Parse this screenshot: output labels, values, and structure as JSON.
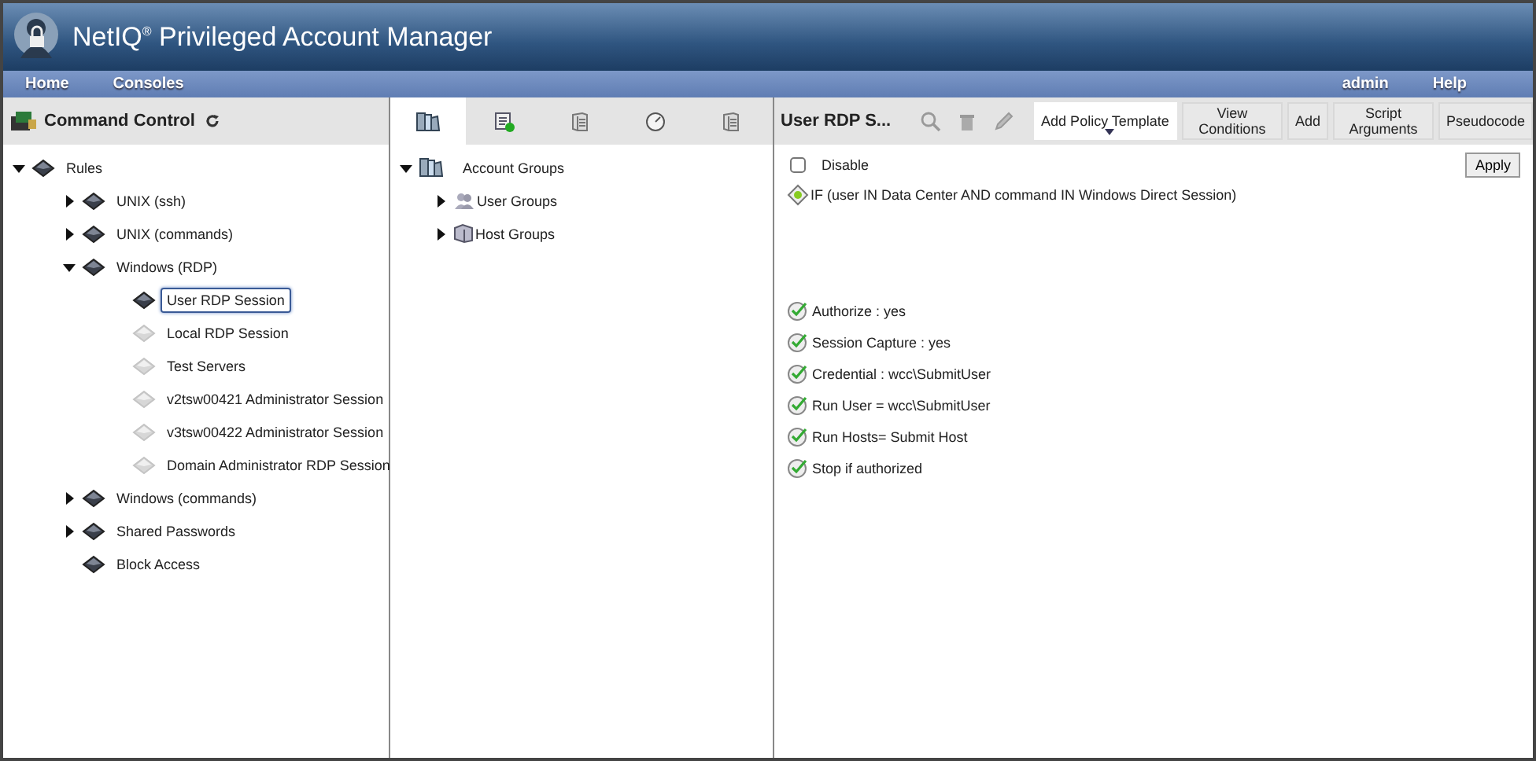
{
  "header": {
    "title": "NetIQ$^{®}$ Privileged Account Manager"
  },
  "menu": {
    "left": [
      "Home",
      "Consoles"
    ],
    "right": [
      "admin",
      "Help"
    ]
  },
  "left_panel": {
    "title": "Command Control",
    "tree": [
      {
        "label": "Rules",
        "expanded": true,
        "disabled": false,
        "selected": false,
        "children": [
          {
            "label": "UNIX (ssh)",
            "expanded": false,
            "disabled": false,
            "selected": false
          },
          {
            "label": "UNIX (commands)",
            "expanded": false,
            "disabled": false,
            "selected": false
          },
          {
            "label": "Windows (RDP)",
            "expanded": true,
            "disabled": false,
            "selected": false,
            "children": [
              {
                "label": "User RDP Session",
                "disabled": false,
                "selected": true
              },
              {
                "label": "Local RDP Session",
                "disabled": true,
                "selected": false
              },
              {
                "label": "Test Servers",
                "disabled": true,
                "selected": false
              },
              {
                "label": "v2tsw00421 Administrator Session",
                "disabled": true,
                "selected": false
              },
              {
                "label": "v3tsw00422 Administrator Session",
                "disabled": true,
                "selected": false
              },
              {
                "label": "Domain Administrator RDP Session",
                "disabled": true,
                "selected": false
              }
            ]
          },
          {
            "label": "Windows (commands)",
            "expanded": false,
            "disabled": false,
            "selected": false
          },
          {
            "label": "Shared Passwords",
            "expanded": false,
            "disabled": false,
            "selected": false
          },
          {
            "label": "Block Access",
            "disabled": false,
            "selected": false
          }
        ]
      }
    ]
  },
  "middle_panel": {
    "tabs": [
      {
        "kind": "groups",
        "selected": true
      },
      {
        "kind": "script",
        "selected": false
      },
      {
        "kind": "server",
        "selected": false
      },
      {
        "kind": "gauge",
        "selected": false
      },
      {
        "kind": "server",
        "selected": false
      }
    ],
    "tree": [
      {
        "label": "Account Groups",
        "kind": "groups",
        "expanded": true,
        "children": [
          {
            "label": "User Groups",
            "kind": "users",
            "expanded": false
          },
          {
            "label": "Host Groups",
            "kind": "hosts",
            "expanded": false
          }
        ]
      }
    ]
  },
  "right_panel": {
    "title": "User RDP S...",
    "buttons": [
      {
        "label": "Add Policy Template",
        "selected": true
      },
      {
        "label": "View Conditions",
        "selected": false
      },
      {
        "label": "Add",
        "selected": false
      },
      {
        "label": "Script Arguments",
        "selected": false
      },
      {
        "label": "Pseudocode",
        "selected": false
      }
    ],
    "disable": {
      "label": "Disable",
      "checked": false
    },
    "apply": "Apply",
    "condition": "IF (user IN Data Center AND command IN Windows Direct Session)",
    "actions": [
      "Authorize : yes",
      "Session Capture : yes",
      "Credential : wcc\\SubmitUser",
      "Run User = wcc\\SubmitUser",
      "Run Hosts= Submit Host",
      "Stop if authorized"
    ]
  }
}
